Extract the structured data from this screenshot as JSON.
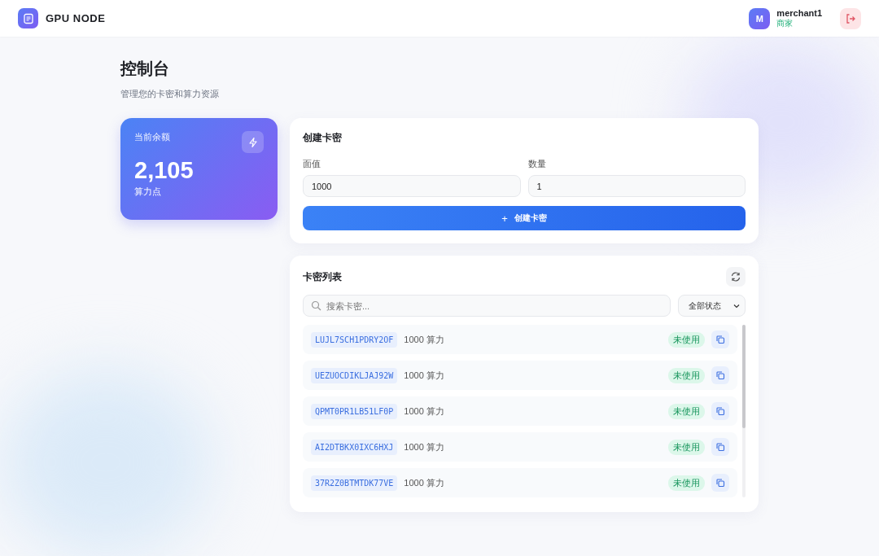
{
  "header": {
    "brand": "GPU NODE",
    "user": {
      "avatar_letter": "M",
      "name": "merchant1",
      "role": "商家"
    }
  },
  "page": {
    "title": "控制台",
    "subtitle": "管理您的卡密和算力资源"
  },
  "balance": {
    "label": "当前余额",
    "amount": "2,105",
    "unit": "算力点"
  },
  "create": {
    "title": "创建卡密",
    "fields": [
      {
        "label": "面值",
        "value": "1000"
      },
      {
        "label": "数量",
        "value": "1"
      }
    ],
    "button": "创建卡密",
    "button_icon": "+"
  },
  "list": {
    "title": "卡密列表",
    "search": {
      "placeholder": "搜索卡密..."
    },
    "filter": "全部状态",
    "rows": [
      {
        "code": "LUJL7SCH1PDRY2OF",
        "amount": "1000 算力",
        "status": "未使用",
        "kind": "unused"
      },
      {
        "code": "UEZUOCDIKLJAJ92W",
        "amount": "1000 算力",
        "status": "未使用",
        "kind": "unused"
      },
      {
        "code": "QPMT0PR1LB51LF0P",
        "amount": "1000 算力",
        "status": "未使用",
        "kind": "unused"
      },
      {
        "code": "AI2DTBKX0IXC6HXJ",
        "amount": "1000 算力",
        "status": "未使用",
        "kind": "unused"
      },
      {
        "code": "37R2Z0BTMTDK77VE",
        "amount": "1000 算力",
        "status": "未使用",
        "kind": "unused"
      }
    ]
  }
}
